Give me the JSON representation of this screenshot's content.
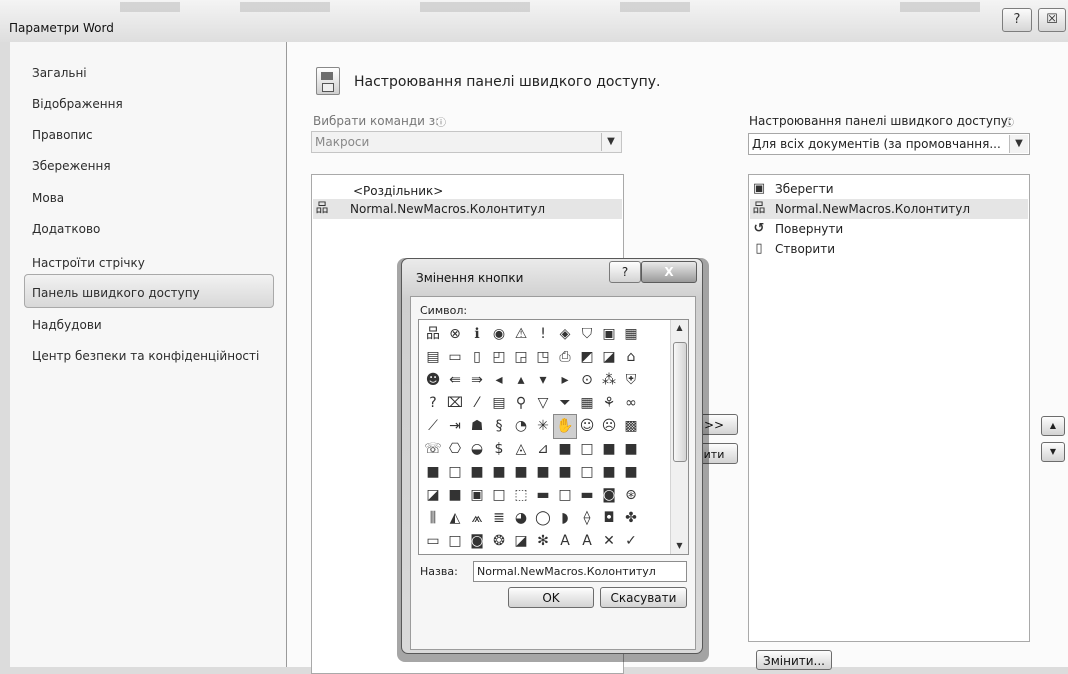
{
  "window": {
    "title": "Параметри Word",
    "help_label": "?",
    "close_label": "☒"
  },
  "sidebar": {
    "items": [
      {
        "label": "Загальні"
      },
      {
        "label": "Відображення"
      },
      {
        "label": "Правопис"
      },
      {
        "label": "Збереження"
      },
      {
        "label": "Мова"
      },
      {
        "label": "Додатково"
      },
      {
        "label": "Настроїти стрічку"
      },
      {
        "label": "Панель швидкого доступу"
      },
      {
        "label": "Надбудови"
      },
      {
        "label": "Центр безпеки та конфіденційності"
      }
    ],
    "selected": "Панель швидкого доступу"
  },
  "main": {
    "heading": "Настроювання панелі швидкого доступу.",
    "choose_commands_label": "Вибрати команди з:",
    "choose_commands_key": "к",
    "choose_commands_value": "Макроси",
    "customize_label": "Настроювання панелі швидкого доступу:",
    "customize_value": "Для всіх документів (за промовчання...",
    "left_list": [
      {
        "label": "<Роздільник>",
        "icon": ""
      },
      {
        "label": "Normal.NewMacros.Колонтитул",
        "icon": "macro-icon"
      }
    ],
    "right_list": [
      {
        "label": "Зберегти",
        "icon": "save-icon"
      },
      {
        "label": "Normal.NewMacros.Колонтитул",
        "icon": "macro-icon"
      },
      {
        "label": "Повернути",
        "icon": "undo-icon"
      },
      {
        "label": "Створити",
        "icon": "new-document-icon"
      }
    ],
    "add_label": ">>",
    "remove_label": "ити",
    "modify_label": "Змінити...",
    "move_up_label": "▲",
    "move_down_label": "▼"
  },
  "dialog": {
    "title": "Змінення кнопки",
    "help_label": "?",
    "close_label": "X",
    "symbol_label": "Символ:",
    "name_label": "Назва:",
    "name_value": "Normal.NewMacros.Колонтитул",
    "ok_label": "OK",
    "cancel_label": "Скасувати",
    "symbols": [
      "品",
      "⊗",
      "ℹ",
      "◉",
      "⚠",
      "!",
      "◈",
      "⛉",
      "▣",
      "▦",
      "▤",
      "▭",
      "▯",
      "◰",
      "◲",
      "◳",
      "⎙",
      "◩",
      "◪",
      "⌂",
      "☻",
      "⇚",
      "⇛",
      "◂",
      "▴",
      "▾",
      "▸",
      "⊙",
      "⁂",
      "⛨",
      "?",
      "⌧",
      "⁄",
      "▤",
      "⚲",
      "▽",
      "⏷",
      "▦",
      "⚘",
      "∞",
      "⟋",
      "⇥",
      "☗",
      "§",
      "◔",
      "✳",
      "✋",
      "☺",
      "☹",
      "▩",
      "☏",
      "⎔",
      "◒",
      "$",
      "◬",
      "⊿",
      "■",
      "□",
      "■",
      "■",
      "■",
      "□",
      "■",
      "■",
      "■",
      "■",
      "■",
      "□",
      "■",
      "■",
      "◪",
      "■",
      "▣",
      "□",
      "⬚",
      "▬",
      "□",
      "▬",
      "◙",
      "⊛",
      "⫼",
      "◭",
      "⩕",
      "≣",
      "◕",
      "◯",
      "◗",
      "⟠",
      "◘",
      "✤",
      "▭",
      "□",
      "◙",
      "❂",
      "◪",
      "✻",
      "A",
      "A",
      "✕",
      "✓"
    ]
  }
}
